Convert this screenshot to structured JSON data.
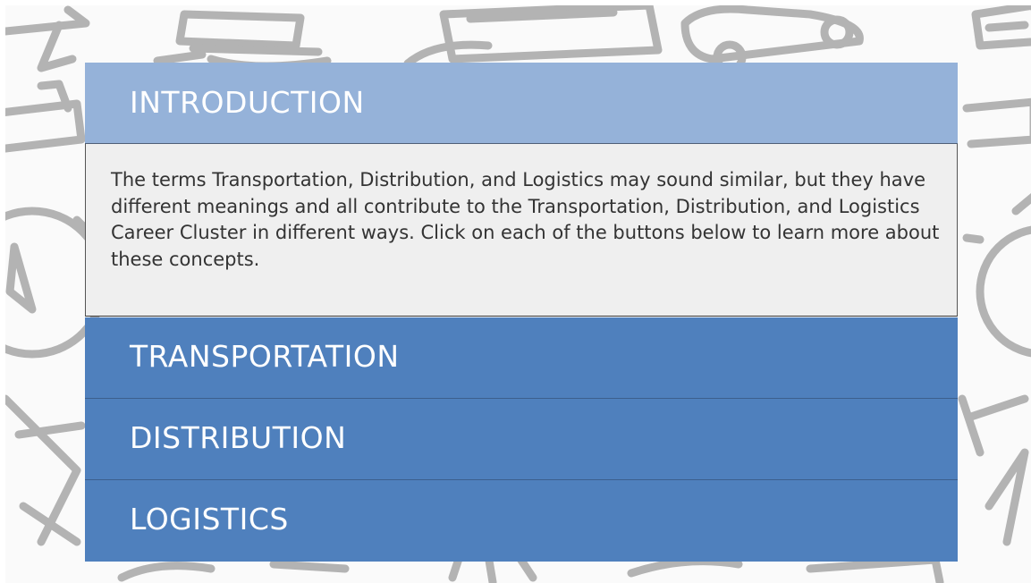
{
  "slide": {
    "header_title": "INTRODUCTION",
    "body_text": "The terms Transportation, Distribution, and Logistics may sound similar, but they have different meanings and all contribute to the Transportation, Distribution, and Logistics Career Cluster in different ways. Click on each of the buttons below to learn more about these concepts.",
    "buttons": [
      {
        "label": "TRANSPORTATION"
      },
      {
        "label": "DISTRIBUTION"
      },
      {
        "label": "LOGISTICS"
      }
    ]
  },
  "colors": {
    "header_bg": "#95b2d9",
    "body_bg": "#efefef",
    "button_bg": "#4f80bd",
    "pattern_stroke": "#b3b3b3"
  },
  "background_icons": [
    "plane-icon",
    "ship-icon",
    "truck-icon",
    "car-icon",
    "compass-icon",
    "stopwatch-icon",
    "bus-icon",
    "ticket-icon"
  ]
}
